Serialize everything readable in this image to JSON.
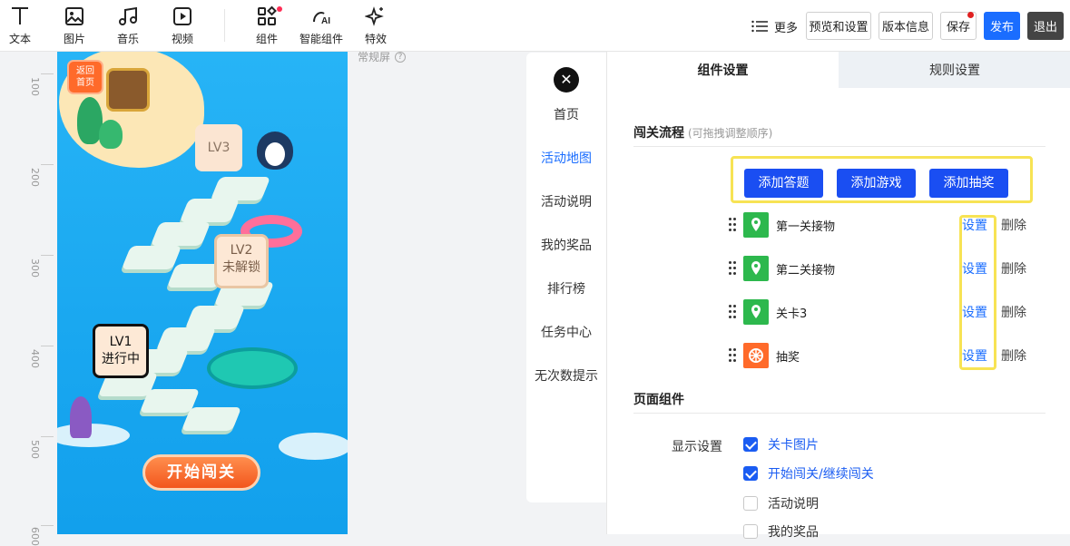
{
  "toolbar": {
    "tools": [
      {
        "label": "文本",
        "icon": "text-icon"
      },
      {
        "label": "图片",
        "icon": "image-icon"
      },
      {
        "label": "音乐",
        "icon": "music-icon"
      },
      {
        "label": "视频",
        "icon": "video-icon"
      },
      {
        "label": "组件",
        "icon": "components-icon"
      },
      {
        "label": "智能组件",
        "icon": "ai-component-icon"
      },
      {
        "label": "特效",
        "icon": "sparkle-icon"
      }
    ],
    "more_label": "更多",
    "preview_label": "预览和设置",
    "version_label": "版本信息",
    "save_label": "保存",
    "publish_label": "发布",
    "exit_label": "退出"
  },
  "canvas": {
    "screen_label": "常规屏",
    "ruler_ticks": [
      "100",
      "200",
      "300",
      "400",
      "500",
      "600"
    ],
    "back_label_line1": "返回",
    "back_label_line2": "首页",
    "levels": {
      "lv3": {
        "title": "LV3"
      },
      "lv2": {
        "title": "LV2",
        "status": "未解锁"
      },
      "lv1": {
        "title": "LV1",
        "status": "进行中"
      }
    },
    "start_button": "开始闯关"
  },
  "nav": {
    "items": [
      "首页",
      "活动地图",
      "活动说明",
      "我的奖品",
      "排行榜",
      "任务中心",
      "无次数提示"
    ],
    "active": "活动地图"
  },
  "panel": {
    "tabs": [
      "组件设置",
      "规则设置"
    ],
    "flow": {
      "title": "闯关流程",
      "hint": "(可拖拽调整顺序)",
      "add_buttons": [
        "添加答题",
        "添加游戏",
        "添加抽奖"
      ],
      "items": [
        {
          "name": "第一关接物",
          "badge": "green"
        },
        {
          "name": "第二关接物",
          "badge": "green"
        },
        {
          "name": "关卡3",
          "badge": "green"
        },
        {
          "name": "抽奖",
          "badge": "orange"
        }
      ],
      "set_label": "设置",
      "delete_label": "删除"
    },
    "page_components": {
      "title": "页面组件",
      "display_label": "显示设置",
      "options": [
        {
          "label": "关卡图片",
          "checked": true
        },
        {
          "label": "开始闯关/继续闯关",
          "checked": true
        },
        {
          "label": "活动说明",
          "checked": false
        },
        {
          "label": "我的奖品",
          "checked": false
        }
      ]
    }
  }
}
